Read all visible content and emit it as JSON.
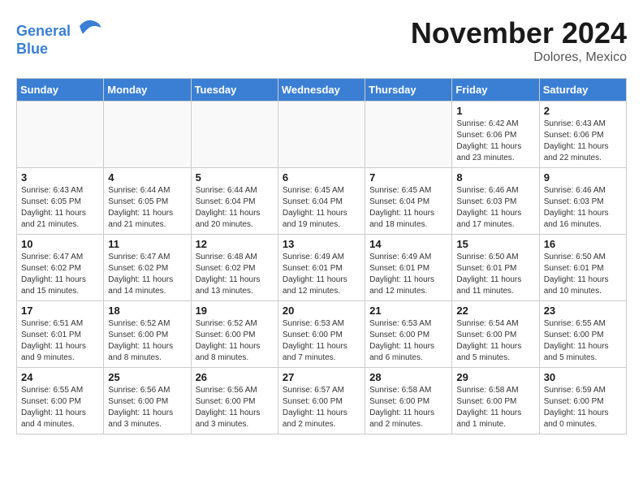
{
  "header": {
    "logo_line1": "General",
    "logo_line2": "Blue",
    "month": "November 2024",
    "location": "Dolores, Mexico"
  },
  "weekdays": [
    "Sunday",
    "Monday",
    "Tuesday",
    "Wednesday",
    "Thursday",
    "Friday",
    "Saturday"
  ],
  "weeks": [
    [
      {
        "day": "",
        "info": ""
      },
      {
        "day": "",
        "info": ""
      },
      {
        "day": "",
        "info": ""
      },
      {
        "day": "",
        "info": ""
      },
      {
        "day": "",
        "info": ""
      },
      {
        "day": "1",
        "info": "Sunrise: 6:42 AM\nSunset: 6:06 PM\nDaylight: 11 hours and 23 minutes."
      },
      {
        "day": "2",
        "info": "Sunrise: 6:43 AM\nSunset: 6:06 PM\nDaylight: 11 hours and 22 minutes."
      }
    ],
    [
      {
        "day": "3",
        "info": "Sunrise: 6:43 AM\nSunset: 6:05 PM\nDaylight: 11 hours and 21 minutes."
      },
      {
        "day": "4",
        "info": "Sunrise: 6:44 AM\nSunset: 6:05 PM\nDaylight: 11 hours and 21 minutes."
      },
      {
        "day": "5",
        "info": "Sunrise: 6:44 AM\nSunset: 6:04 PM\nDaylight: 11 hours and 20 minutes."
      },
      {
        "day": "6",
        "info": "Sunrise: 6:45 AM\nSunset: 6:04 PM\nDaylight: 11 hours and 19 minutes."
      },
      {
        "day": "7",
        "info": "Sunrise: 6:45 AM\nSunset: 6:04 PM\nDaylight: 11 hours and 18 minutes."
      },
      {
        "day": "8",
        "info": "Sunrise: 6:46 AM\nSunset: 6:03 PM\nDaylight: 11 hours and 17 minutes."
      },
      {
        "day": "9",
        "info": "Sunrise: 6:46 AM\nSunset: 6:03 PM\nDaylight: 11 hours and 16 minutes."
      }
    ],
    [
      {
        "day": "10",
        "info": "Sunrise: 6:47 AM\nSunset: 6:02 PM\nDaylight: 11 hours and 15 minutes."
      },
      {
        "day": "11",
        "info": "Sunrise: 6:47 AM\nSunset: 6:02 PM\nDaylight: 11 hours and 14 minutes."
      },
      {
        "day": "12",
        "info": "Sunrise: 6:48 AM\nSunset: 6:02 PM\nDaylight: 11 hours and 13 minutes."
      },
      {
        "day": "13",
        "info": "Sunrise: 6:49 AM\nSunset: 6:01 PM\nDaylight: 11 hours and 12 minutes."
      },
      {
        "day": "14",
        "info": "Sunrise: 6:49 AM\nSunset: 6:01 PM\nDaylight: 11 hours and 12 minutes."
      },
      {
        "day": "15",
        "info": "Sunrise: 6:50 AM\nSunset: 6:01 PM\nDaylight: 11 hours and 11 minutes."
      },
      {
        "day": "16",
        "info": "Sunrise: 6:50 AM\nSunset: 6:01 PM\nDaylight: 11 hours and 10 minutes."
      }
    ],
    [
      {
        "day": "17",
        "info": "Sunrise: 6:51 AM\nSunset: 6:01 PM\nDaylight: 11 hours and 9 minutes."
      },
      {
        "day": "18",
        "info": "Sunrise: 6:52 AM\nSunset: 6:00 PM\nDaylight: 11 hours and 8 minutes."
      },
      {
        "day": "19",
        "info": "Sunrise: 6:52 AM\nSunset: 6:00 PM\nDaylight: 11 hours and 8 minutes."
      },
      {
        "day": "20",
        "info": "Sunrise: 6:53 AM\nSunset: 6:00 PM\nDaylight: 11 hours and 7 minutes."
      },
      {
        "day": "21",
        "info": "Sunrise: 6:53 AM\nSunset: 6:00 PM\nDaylight: 11 hours and 6 minutes."
      },
      {
        "day": "22",
        "info": "Sunrise: 6:54 AM\nSunset: 6:00 PM\nDaylight: 11 hours and 5 minutes."
      },
      {
        "day": "23",
        "info": "Sunrise: 6:55 AM\nSunset: 6:00 PM\nDaylight: 11 hours and 5 minutes."
      }
    ],
    [
      {
        "day": "24",
        "info": "Sunrise: 6:55 AM\nSunset: 6:00 PM\nDaylight: 11 hours and 4 minutes."
      },
      {
        "day": "25",
        "info": "Sunrise: 6:56 AM\nSunset: 6:00 PM\nDaylight: 11 hours and 3 minutes."
      },
      {
        "day": "26",
        "info": "Sunrise: 6:56 AM\nSunset: 6:00 PM\nDaylight: 11 hours and 3 minutes."
      },
      {
        "day": "27",
        "info": "Sunrise: 6:57 AM\nSunset: 6:00 PM\nDaylight: 11 hours and 2 minutes."
      },
      {
        "day": "28",
        "info": "Sunrise: 6:58 AM\nSunset: 6:00 PM\nDaylight: 11 hours and 2 minutes."
      },
      {
        "day": "29",
        "info": "Sunrise: 6:58 AM\nSunset: 6:00 PM\nDaylight: 11 hours and 1 minute."
      },
      {
        "day": "30",
        "info": "Sunrise: 6:59 AM\nSunset: 6:00 PM\nDaylight: 11 hours and 0 minutes."
      }
    ]
  ]
}
